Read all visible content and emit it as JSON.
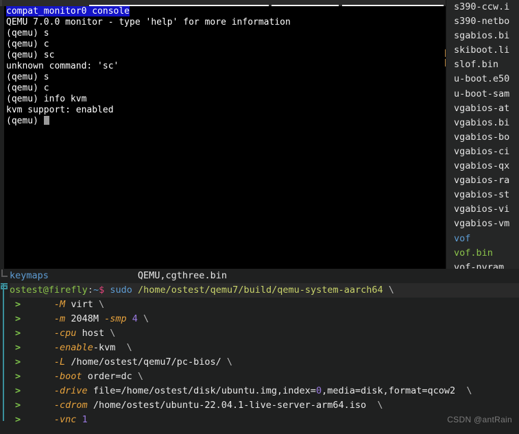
{
  "qemu_console": {
    "title": "compat_monitor0 console",
    "lines": [
      "QEMU 7.0.0 monitor - type 'help' for more information",
      "(qemu) s",
      "(qemu) c",
      "(qemu) sc",
      "unknown command: 'sc'",
      "(qemu) s",
      "(qemu) c",
      "(qemu) info kvm",
      "kvm support: enabled",
      "(qemu) "
    ]
  },
  "file_sidebar": {
    "items": [
      {
        "name": "s390-ccw.i",
        "kind": "file"
      },
      {
        "name": "s390-netbo",
        "kind": "file"
      },
      {
        "name": "sgabios.bi",
        "kind": "file"
      },
      {
        "name": "skiboot.li",
        "kind": "file"
      },
      {
        "name": "slof.bin",
        "kind": "file"
      },
      {
        "name": "u-boot.e50",
        "kind": "file"
      },
      {
        "name": "u-boot-sam",
        "kind": "file"
      },
      {
        "name": "vgabios-at",
        "kind": "file"
      },
      {
        "name": "vgabios.bi",
        "kind": "file"
      },
      {
        "name": "vgabios-bo",
        "kind": "file"
      },
      {
        "name": "vgabios-ci",
        "kind": "file"
      },
      {
        "name": "vgabios-qx",
        "kind": "file"
      },
      {
        "name": "vgabios-ra",
        "kind": "file"
      },
      {
        "name": "vgabios-st",
        "kind": "file"
      },
      {
        "name": "vgabios-vi",
        "kind": "file"
      },
      {
        "name": "vgabios-vm",
        "kind": "file"
      },
      {
        "name": "vof",
        "kind": "dir"
      },
      {
        "name": "vof.bin",
        "kind": "exe"
      },
      {
        "name": "vof-nvram.",
        "kind": "file"
      }
    ]
  },
  "status_line": {
    "left": "keymaps",
    "center": "QEMU,cgthree.bin"
  },
  "terminal": {
    "prompt": {
      "user_host": "ostest@firefly",
      "colon": ":",
      "path": "~",
      "sigil": "$"
    },
    "command_head": {
      "sudo": "sudo",
      "binary": "/home/ostest/qemu7/build/qemu-system-aarch64",
      "cont": "\\"
    },
    "continuation_symbol": ">",
    "arg_lines": [
      {
        "flag": "-M",
        "value": " virt ",
        "cont": "\\"
      },
      {
        "flag": "-m",
        "value": " 2048M ",
        "flag2": "-smp",
        "value2": " ",
        "num": "4",
        "tail": " ",
        "cont": "\\"
      },
      {
        "flag": "-cpu",
        "value": " host ",
        "cont": "\\"
      },
      {
        "flag": "-enable",
        "value": "-kvm  ",
        "cont": "\\"
      },
      {
        "flag": "-L",
        "value": " /home/ostest/qemu7/pc-bios/ ",
        "cont": "\\"
      },
      {
        "flag": "-boot",
        "value": " order=dc ",
        "cont": "\\"
      },
      {
        "flag": "-drive",
        "value": " file=/home/ostest/disk/ubuntu.img,index=",
        "num": "0",
        "value2": ",media=disk,format=qcow2  ",
        "cont": "\\"
      },
      {
        "flag": "-cdrom",
        "value": " /home/ostest/ubuntu-22.04.1-live-server-arm64.iso  ",
        "cont": "\\"
      },
      {
        "flag": "-vnc",
        "value": " ",
        "num": "1",
        "cont": ""
      }
    ]
  },
  "watermark": "CSDN @antRain",
  "colors": {
    "qemu_bg": "#000000",
    "qemu_title_highlight": "#1414c8",
    "editor_bg": "#1f2020",
    "sidebar_bg": "#252626",
    "cmd_row_bg": "#2a2a2a",
    "accent_teal": "#3a8f9c",
    "flag_orange": "#e8a33d",
    "prompt_green": "#8bc34a",
    "number_purple": "#9a7ae0",
    "dollar_pink": "#e0437a",
    "dir_blue": "#5e9cd3",
    "tick_orange": "#c08b42"
  }
}
